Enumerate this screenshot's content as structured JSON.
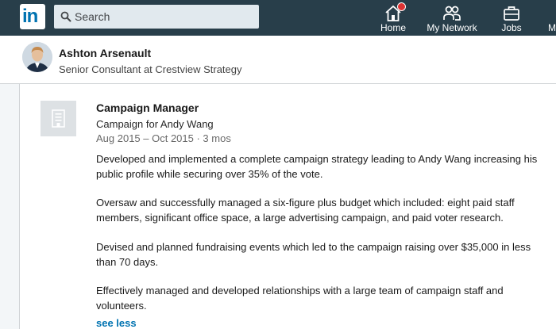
{
  "nav": {
    "logo_text": "in",
    "search": {
      "placeholder": "Search"
    },
    "items": [
      {
        "label": "Home",
        "icon": "home-icon",
        "has_badge": true
      },
      {
        "label": "My Network",
        "icon": "network-icon"
      },
      {
        "label": "Jobs",
        "icon": "jobs-icon"
      },
      {
        "label": "M",
        "icon": "messaging-icon"
      }
    ],
    "colors": {
      "bar": "#283e4a",
      "badge": "#dd3333",
      "brand": "#0073b1"
    }
  },
  "profile": {
    "name": "Ashton Arsenault",
    "headline": "Senior Consultant at Crestview Strategy"
  },
  "experience": {
    "title": "Campaign Manager",
    "company": "Campaign for Andy Wang",
    "dates": "Aug 2015 – Oct 2015 · 3 mos",
    "description": [
      "Developed and implemented a complete campaign strategy leading to Andy Wang increasing his public profile while securing over 35% of the vote.",
      "Oversaw and successfully managed a six-figure plus budget which included: eight paid staff members, significant office space, a large advertising campaign, and paid voter research.",
      "Devised and planned fundraising events which led to the campaign raising over $35,000 in less than 70 days.",
      "Effectively managed and developed relationships with a large team of campaign staff and volunteers."
    ],
    "toggle_label": "see less"
  }
}
